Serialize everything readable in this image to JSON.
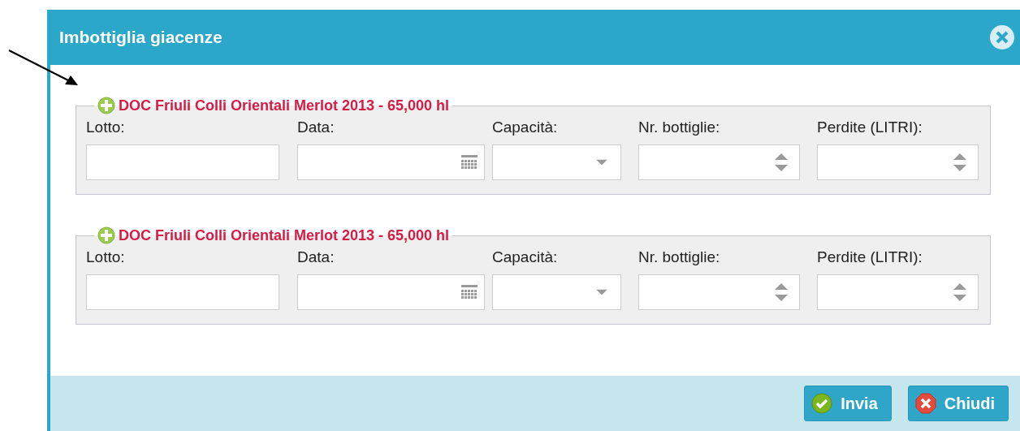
{
  "dialog": {
    "title": "Imbottiglia giacenze"
  },
  "groups": [
    {
      "legend": "DOC Friuli Colli Orientali Merlot 2013 - 65,000 hl",
      "fields": [
        {
          "label": "Lotto:",
          "kind": "text"
        },
        {
          "label": "Data:",
          "kind": "date"
        },
        {
          "label": "Capacità:",
          "kind": "select"
        },
        {
          "label": "Nr. bottiglie:",
          "kind": "number"
        },
        {
          "label": "Perdite (LITRI):",
          "kind": "number"
        }
      ]
    },
    {
      "legend": "DOC Friuli Colli Orientali Merlot 2013 - 65,000 hl",
      "fields": [
        {
          "label": "Lotto:",
          "kind": "text"
        },
        {
          "label": "Data:",
          "kind": "date"
        },
        {
          "label": "Capacità:",
          "kind": "select"
        },
        {
          "label": "Nr. bottiglie:",
          "kind": "number"
        },
        {
          "label": "Perdite (LITRI):",
          "kind": "number"
        }
      ]
    }
  ],
  "buttons": [
    {
      "label": "Invia",
      "kind": "ok"
    },
    {
      "label": "Chiudi",
      "kind": "close"
    }
  ]
}
